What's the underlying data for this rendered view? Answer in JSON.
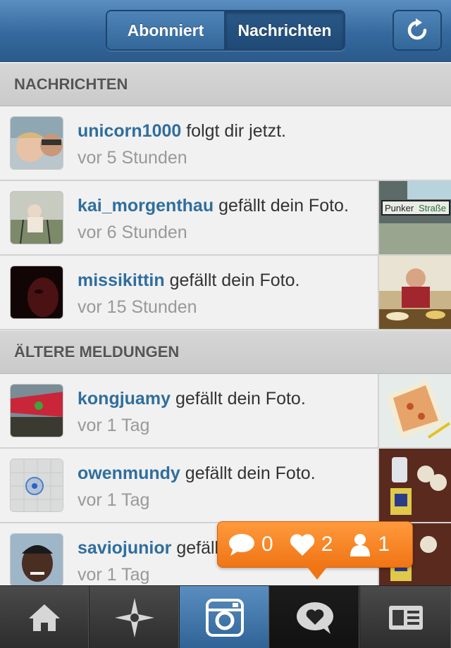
{
  "header": {
    "tabs": [
      {
        "label": "Abonniert",
        "selected": false
      },
      {
        "label": "Nachrichten",
        "selected": true
      }
    ],
    "refresh_icon": "refresh-icon"
  },
  "sections": {
    "news": "NACHRICHTEN",
    "older": "ÄLTERE MELDUNGEN"
  },
  "news": [
    {
      "user": "unicorn1000",
      "action": "folgt dir jetzt.",
      "time": "vor 5 Stunden"
    },
    {
      "user": "kai_morgenthau",
      "action": "gefällt dein Foto.",
      "time": "vor 6 Stunden"
    },
    {
      "user": "missikittin",
      "action": "gefällt dein Foto.",
      "time": "vor 15 Stunden"
    }
  ],
  "older": [
    {
      "user": "kongjuamy",
      "action": "gefällt dein Foto.",
      "time": "vor 1 Tag"
    },
    {
      "user": "owenmundy",
      "action": "gefällt dein Foto.",
      "time": "vor 1 Tag"
    },
    {
      "user": "saviojunior",
      "action": "gefällt dein Foto.",
      "time": "vor 1 Tag"
    }
  ],
  "popup": {
    "comments": "0",
    "likes": "2",
    "followers": "1"
  },
  "tabbar": [
    {
      "icon": "home-icon"
    },
    {
      "icon": "explore-icon"
    },
    {
      "icon": "camera-icon",
      "active": true
    },
    {
      "icon": "news-icon",
      "selected": true
    },
    {
      "icon": "profile-icon"
    }
  ],
  "colors": {
    "header_blue": "#35699e",
    "username_blue": "#2f6e9e",
    "popup_orange": "#f07515"
  }
}
